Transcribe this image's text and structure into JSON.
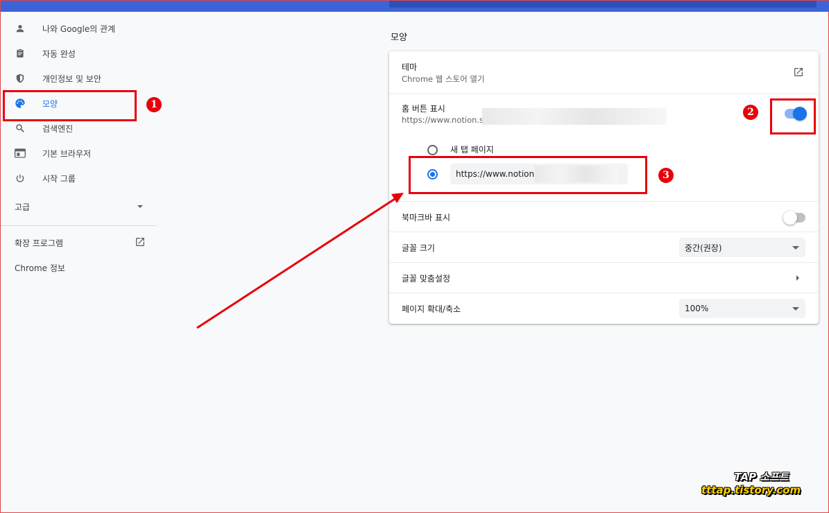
{
  "colors": {
    "accent": "#1a73e8",
    "annotation_red": "#e8000b",
    "topbar": "#3c64d8"
  },
  "sidebar": {
    "items": [
      {
        "label": "나와 Google의 관계",
        "icon": "person-icon"
      },
      {
        "label": "자동 완성",
        "icon": "clipboard-icon"
      },
      {
        "label": "개인정보 및 보안",
        "icon": "shield-icon"
      },
      {
        "label": "모양",
        "icon": "palette-icon",
        "active": true
      },
      {
        "label": "검색엔진",
        "icon": "search-icon"
      },
      {
        "label": "기본 브라우저",
        "icon": "browser-icon"
      },
      {
        "label": "시작 그룹",
        "icon": "power-icon"
      }
    ],
    "advanced_label": "고급",
    "extensions_label": "확장 프로그램",
    "about_label": "Chrome 정보"
  },
  "appearance": {
    "section_title": "모양",
    "theme": {
      "label": "테마",
      "sub": "Chrome 웹 스토어 열기"
    },
    "home_button": {
      "label": "홈 버튼 표시",
      "sub": "https://www.notion.so",
      "enabled": true,
      "options": {
        "new_tab_label": "새 탭 페이지",
        "custom_url_value": "https://www.notion.so"
      }
    },
    "bookmarks_bar": {
      "label": "북마크바 표시",
      "enabled": false
    },
    "font_size": {
      "label": "글꼴 크기",
      "value": "중간(권장)"
    },
    "customize_fonts": {
      "label": "글꼴 맞춤설정"
    },
    "page_zoom": {
      "label": "페이지 확대/축소",
      "value": "100%"
    }
  },
  "annotations": {
    "badge_1": "1",
    "badge_2": "2",
    "badge_3": "3"
  },
  "watermark": {
    "line1": "TAP 소프트",
    "line2": "tttap.tistory.com"
  }
}
